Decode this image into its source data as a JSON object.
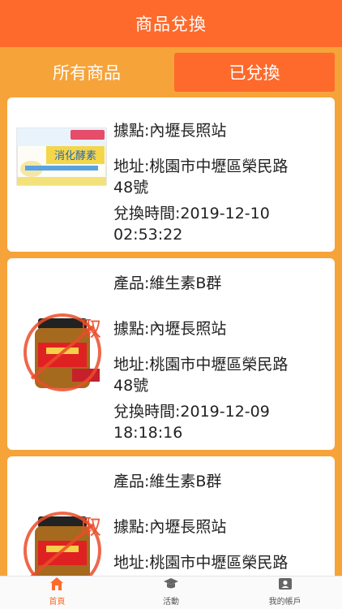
{
  "header": {
    "title": "商品兌換"
  },
  "tabs": [
    {
      "label": "所有商品"
    },
    {
      "label": "已兌換"
    }
  ],
  "cards": [
    {
      "location": "據點:內壢長照站",
      "address_1": "地址:桃園市中壢區榮民路",
      "address_2": "48號",
      "time_1": "兌換時間:2019-12-10",
      "time_2": "02:53:22",
      "product_image_text": "消化酵素"
    },
    {
      "product": "產品:維生素B群",
      "location": "據點:內壢長照站",
      "address_1": "地址:桃園市中壢區榮民路",
      "address_2": "48號",
      "time_1": "兌換時間:2019-12-09",
      "time_2": "18:18:16",
      "stamp_text": "取"
    },
    {
      "product": "產品:維生素B群",
      "location": "據點:內壢長照站",
      "address_1": "地址:桃園市中壢區榮民路",
      "stamp_text": "取"
    }
  ],
  "tabbar": [
    {
      "label": "首頁",
      "icon": "home-icon",
      "active": true
    },
    {
      "label": "活動",
      "icon": "graduation-cap-icon",
      "active": false
    },
    {
      "label": "我的帳戶",
      "icon": "account-card-icon",
      "active": false
    }
  ],
  "colors": {
    "accent": "#fd6a2c",
    "background": "#f6a33a"
  }
}
